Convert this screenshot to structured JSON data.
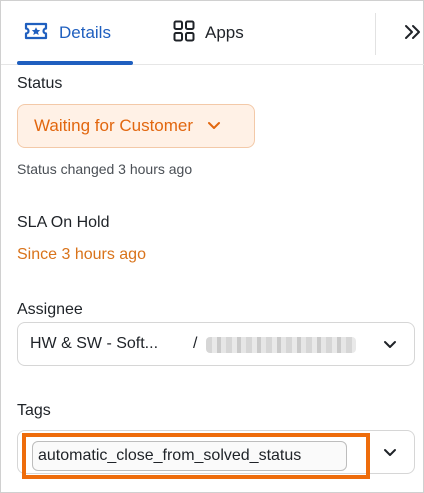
{
  "tabs": [
    {
      "label": "Details",
      "icon": "ticket-star-icon",
      "active": true
    },
    {
      "label": "Apps",
      "icon": "grid-icon",
      "active": false
    }
  ],
  "collapse": {
    "icon": "double-chevron-right-icon"
  },
  "status": {
    "label": "Status",
    "value": "Waiting for Customer",
    "changed_note": "Status changed 3 hours ago"
  },
  "sla": {
    "label": "SLA On Hold",
    "since": "Since 3 hours ago"
  },
  "assignee": {
    "label": "Assignee",
    "group": "HW & SW - Soft...",
    "separator": "/"
  },
  "tags": {
    "label": "Tags",
    "items": [
      "automatic_close_from_solved_status"
    ]
  },
  "colors": {
    "accent": "#1f5fbf",
    "status_text": "#e2670f",
    "status_bg": "#fff1e6",
    "highlight": "#ee6c0b",
    "sla_text": "#d9731a"
  }
}
